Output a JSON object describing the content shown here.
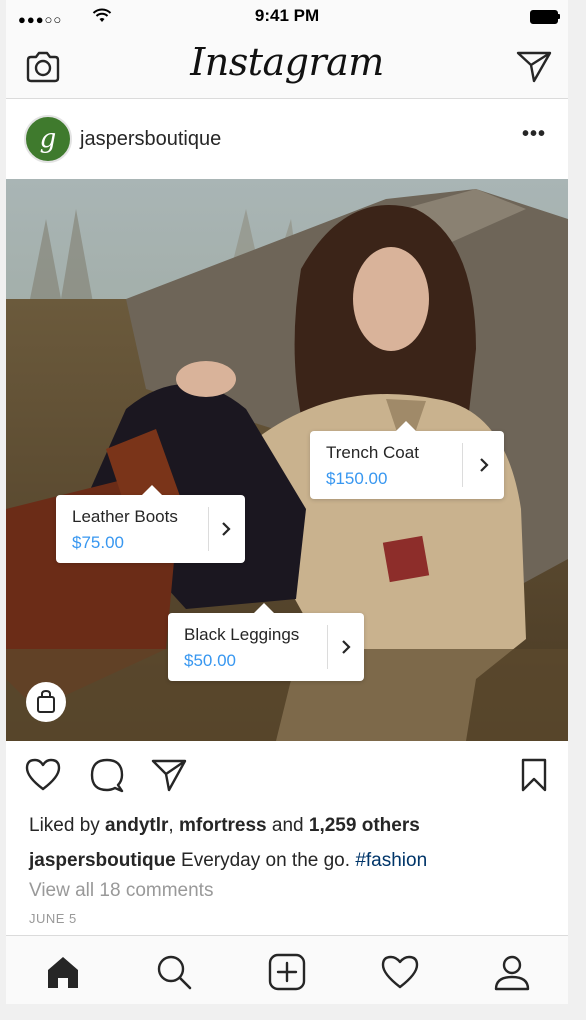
{
  "status_bar": {
    "signal": "●●●○○",
    "time": "9:41 PM"
  },
  "nav": {
    "logo": "Instagram"
  },
  "post": {
    "username": "jaspersboutique",
    "more": "•••",
    "avatar_letter": "g",
    "tags": [
      {
        "name": "Trench Coat",
        "price": "$150.00"
      },
      {
        "name": "Leather Boots",
        "price": "$75.00"
      },
      {
        "name": "Black Leggings",
        "price": "$50.00"
      }
    ],
    "likes": {
      "prefix": "Liked by ",
      "user1": "andytlr",
      "sep": ", ",
      "user2": "mfortress",
      "and": " and ",
      "others": "1,259 others"
    },
    "caption": {
      "username": "jaspersboutique",
      "text": " Everyday on the go. ",
      "hashtag": "#fashion"
    },
    "view_comments": "View all 18 comments",
    "date": "JUNE 5"
  },
  "colors": {
    "price": "#3897f0",
    "hashtag": "#003569",
    "avatar": "#3f7a2d"
  },
  "icons": [
    "camera-icon",
    "send-icon",
    "heart-icon",
    "comment-icon",
    "share-icon",
    "bookmark-icon",
    "shopping-bag-icon",
    "home-icon",
    "search-icon",
    "add-icon",
    "activity-heart-icon",
    "profile-icon",
    "chevron-right-icon"
  ]
}
